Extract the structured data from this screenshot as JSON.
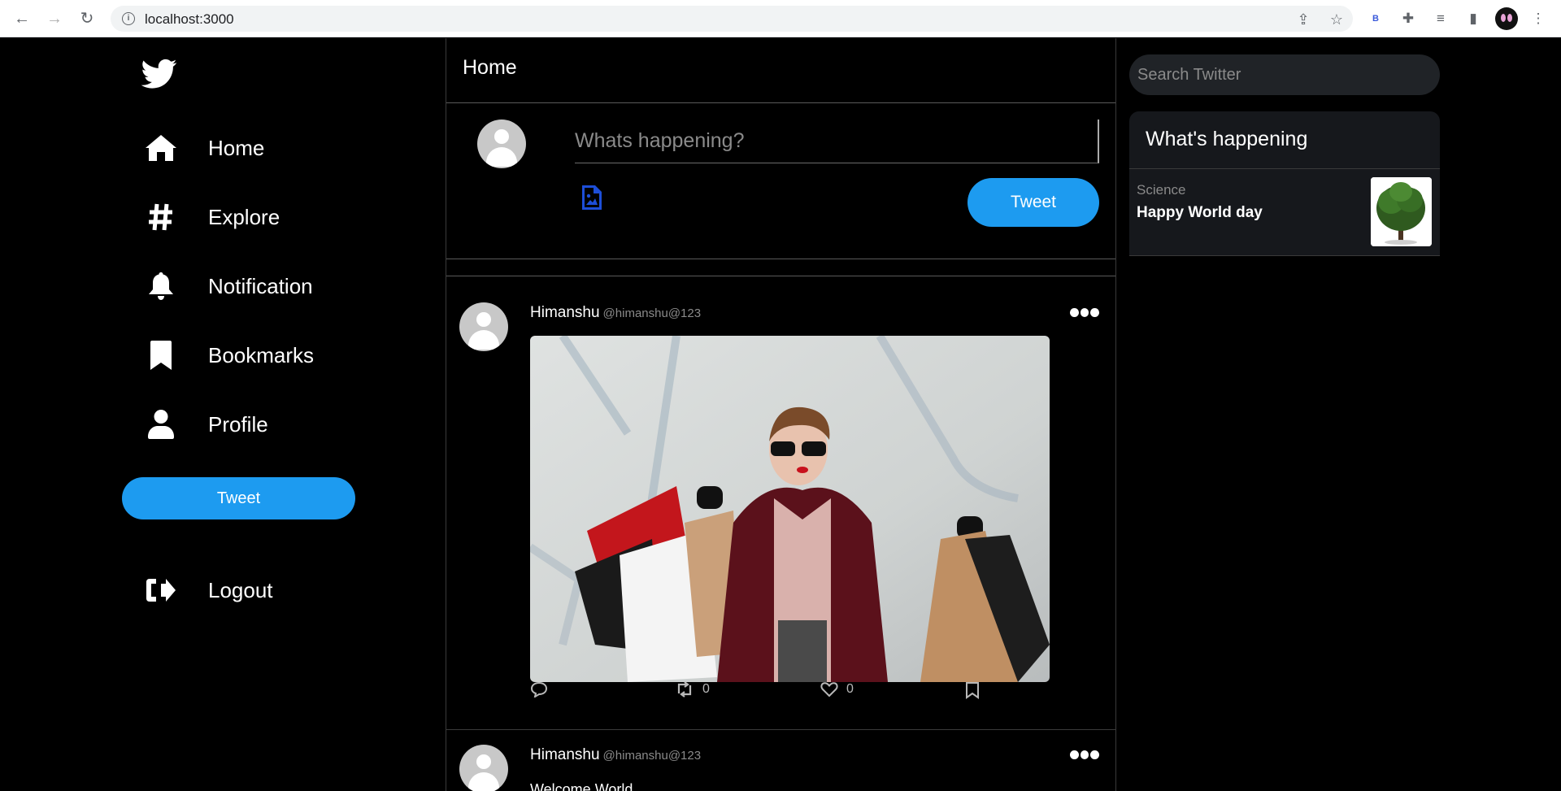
{
  "browser": {
    "url": "localhost:3000"
  },
  "sidebar": {
    "items": [
      {
        "label": "Home",
        "icon": "home-icon"
      },
      {
        "label": "Explore",
        "icon": "hashtag-icon"
      },
      {
        "label": "Notification",
        "icon": "bell-icon"
      },
      {
        "label": "Bookmarks",
        "icon": "bookmark-icon"
      },
      {
        "label": "Profile",
        "icon": "user-icon"
      }
    ],
    "tweet_label": "Tweet",
    "logout_label": "Logout"
  },
  "main": {
    "title": "Home",
    "composer": {
      "placeholder": "Whats happening?",
      "tweet_label": "Tweet"
    },
    "posts": [
      {
        "name": "Himanshu",
        "handle": "@himanshu@123",
        "retweets": "0",
        "likes": "0"
      },
      {
        "name": "Himanshu",
        "handle": "@himanshu@123",
        "text": "Welcome World"
      }
    ]
  },
  "right": {
    "search_placeholder": "Search Twitter",
    "trends_title": "What's happening",
    "trend": {
      "category": "Science",
      "title": "Happy World day"
    }
  },
  "colors": {
    "accent": "#1d9bf0",
    "background": "#000000",
    "panel": "#16181c",
    "upload_icon": "#1d4ed8"
  }
}
